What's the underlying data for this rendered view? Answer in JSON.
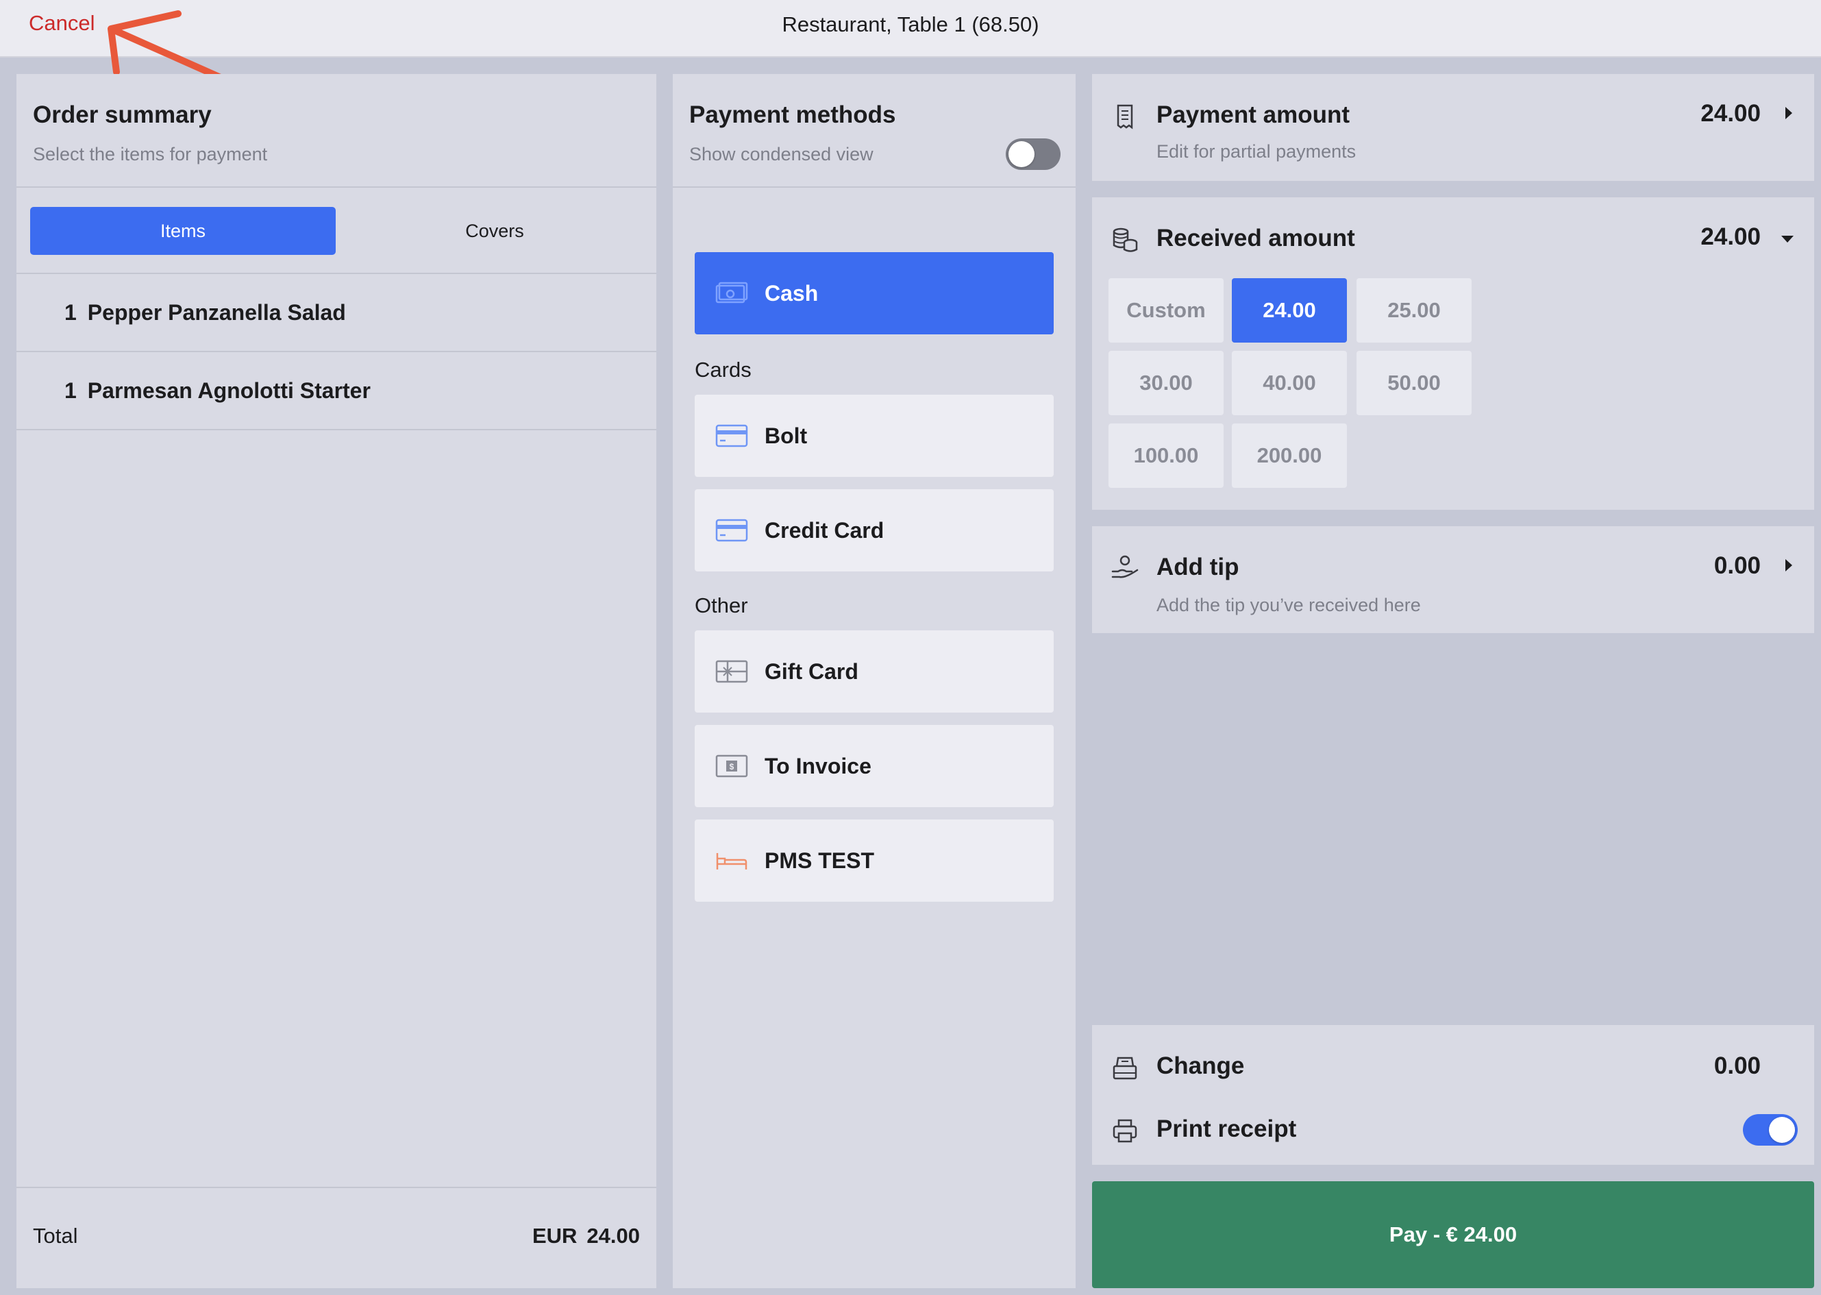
{
  "header": {
    "cancel_label": "Cancel",
    "title": "Restaurant, Table 1 (68.50)"
  },
  "order_summary": {
    "title": "Order summary",
    "subtitle": "Select the items for payment",
    "tabs": [
      {
        "label": "Items",
        "selected": true
      },
      {
        "label": "Covers",
        "selected": false
      }
    ],
    "items": [
      {
        "qty": "1",
        "name": "Pepper Panzanella Salad"
      },
      {
        "qty": "1",
        "name": "Parmesan Agnolotti Starter"
      }
    ],
    "total_label": "Total",
    "total_currency": "EUR",
    "total_amount": "24.00"
  },
  "payment_methods": {
    "title": "Payment methods",
    "condensed_label": "Show condensed view",
    "condensed_on": false,
    "cash_label": "Cash",
    "cards_label": "Cards",
    "cards": [
      {
        "label": "Bolt",
        "icon": "credit-card-icon"
      },
      {
        "label": "Credit Card",
        "icon": "credit-card-icon"
      }
    ],
    "other_label": "Other",
    "other": [
      {
        "label": "Gift Card",
        "icon": "gift-card-icon"
      },
      {
        "label": "To Invoice",
        "icon": "invoice-icon"
      },
      {
        "label": "PMS TEST",
        "icon": "bed-icon"
      }
    ]
  },
  "payment_amount": {
    "title": "Payment amount",
    "subtitle": "Edit for partial payments",
    "value": "24.00"
  },
  "received_amount": {
    "title": "Received amount",
    "value": "24.00",
    "options": [
      "Custom",
      "24.00",
      "25.00",
      "30.00",
      "40.00",
      "50.00",
      "100.00",
      "200.00"
    ],
    "selected": "24.00"
  },
  "tip": {
    "title": "Add tip",
    "subtitle": "Add the tip you’ve received here",
    "value": "0.00"
  },
  "change": {
    "title": "Change",
    "value": "0.00"
  },
  "print_receipt": {
    "title": "Print receipt",
    "on": true
  },
  "pay_button": {
    "label": "Pay - € 24.00"
  },
  "colors": {
    "accent": "#3c6cf0",
    "pay": "#378664",
    "cancel": "#cc2a2a",
    "annotation": "#e8583a"
  }
}
